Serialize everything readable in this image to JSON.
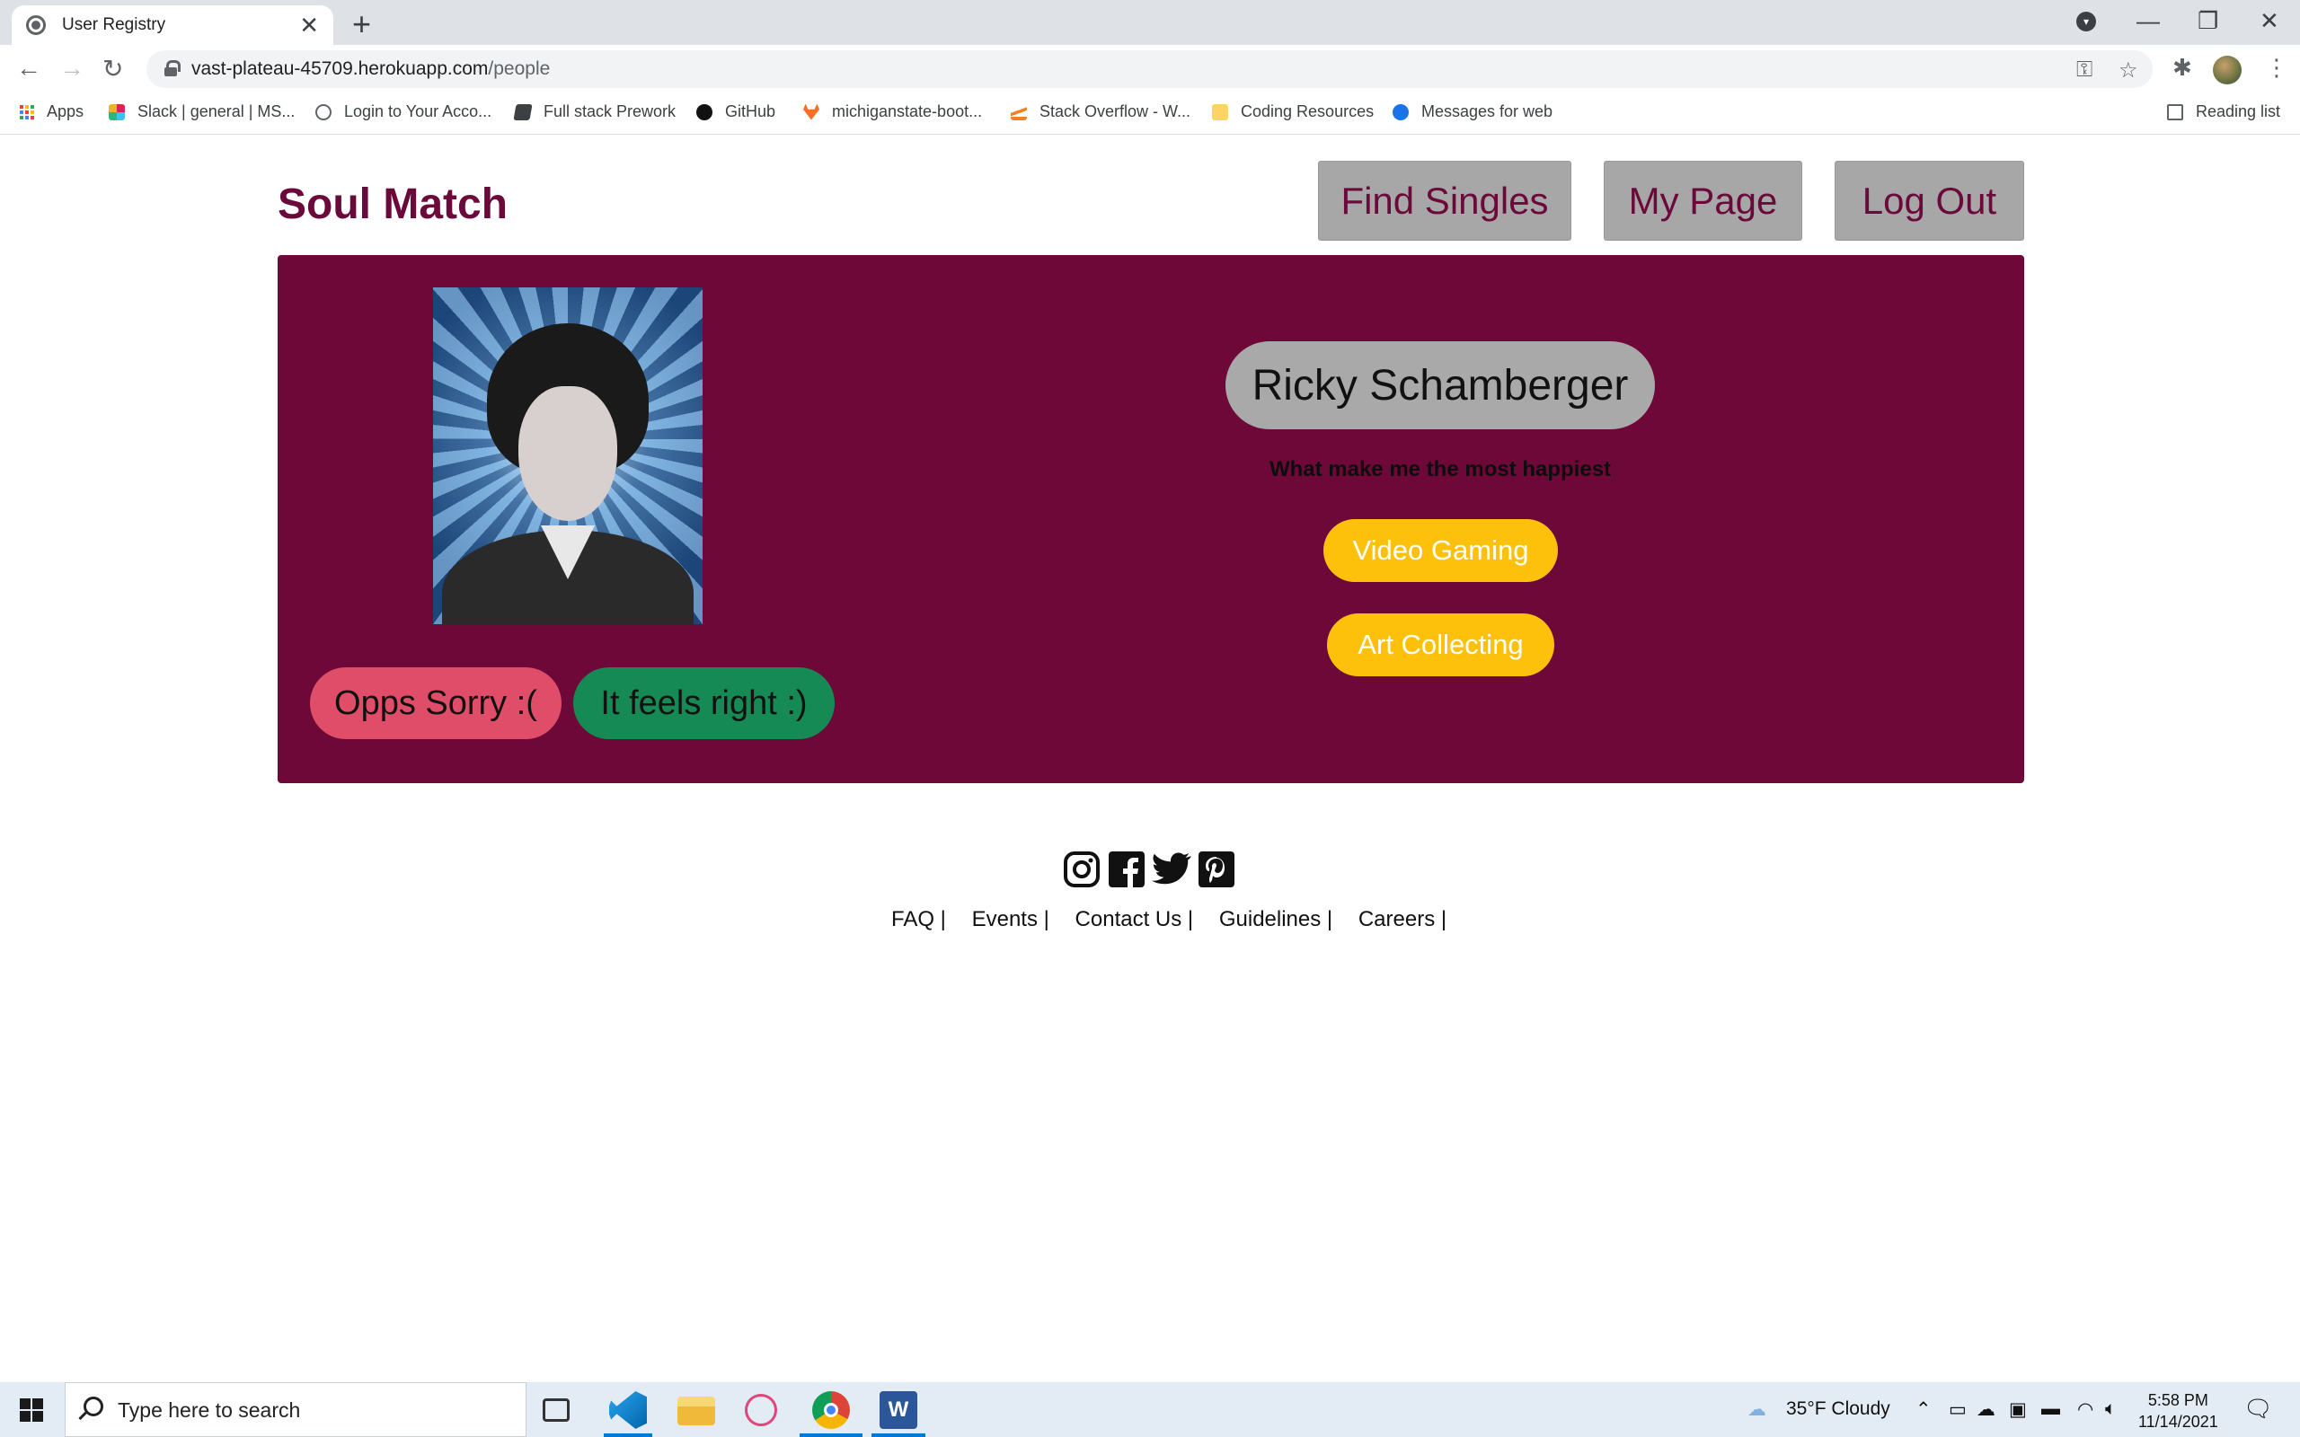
{
  "browser": {
    "tab_title": "User Registry",
    "tab_close": "✕",
    "new_tab": "+",
    "url_host": "vast-plateau-45709.herokuapp.com",
    "url_path": "/people",
    "bookmarks": [
      {
        "label": "Apps",
        "icon": "apps-grid-icon"
      },
      {
        "label": "Slack | general | MS...",
        "icon": "slack-icon"
      },
      {
        "label": "Login to Your Acco...",
        "icon": "globe-icon"
      },
      {
        "label": "Full stack Prework",
        "icon": "book-icon"
      },
      {
        "label": "GitHub",
        "icon": "github-icon"
      },
      {
        "label": "michiganstate-boot...",
        "icon": "gitlab-icon"
      },
      {
        "label": "Stack Overflow - W...",
        "icon": "stackoverflow-icon"
      },
      {
        "label": "Coding Resources",
        "icon": "folder-icon"
      },
      {
        "label": "Messages for web",
        "icon": "messages-icon"
      }
    ],
    "reading_list": "Reading list"
  },
  "site": {
    "brand": "Soul Match",
    "nav": {
      "find_singles": "Find Singles",
      "my_page": "My Page",
      "log_out": "Log Out"
    }
  },
  "profile": {
    "name": "Ricky Schamberger",
    "happiest_heading": "What make me the most happiest",
    "hobbies": [
      "Video Gaming",
      "Art Collecting"
    ],
    "reject_label": "Opps Sorry :(",
    "accept_label": "It feels right :)"
  },
  "footer": {
    "social": [
      "instagram-icon",
      "facebook-icon",
      "twitter-icon",
      "pinterest-icon"
    ],
    "links": [
      "FAQ |",
      "Events |",
      "Contact Us |",
      "Guidelines |",
      "Careers |"
    ]
  },
  "taskbar": {
    "search_placeholder": "Type here to search",
    "weather": "35°F  Cloudy",
    "time": "5:58 PM",
    "date": "11/14/2021"
  },
  "colors": {
    "brand": "#6b0a3a",
    "card_bg": "#6d0838",
    "reject": "#e04d68",
    "accept": "#168a55",
    "hobby": "#fdc10c",
    "nav_btn": "#a7a7a7"
  }
}
